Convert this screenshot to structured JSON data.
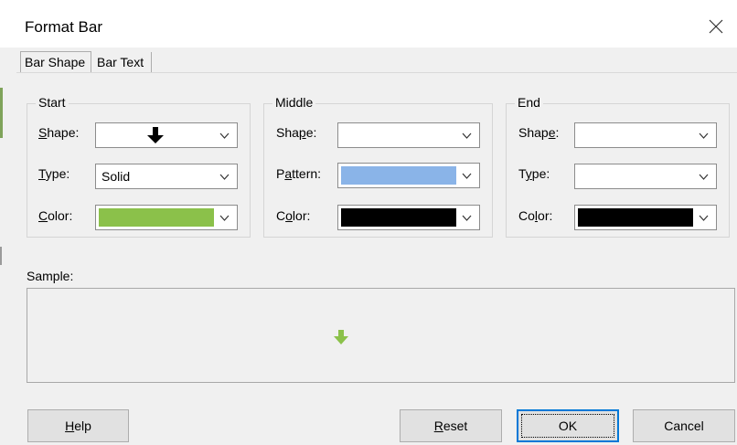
{
  "window": {
    "title": "Format Bar"
  },
  "tabs": [
    {
      "label": "Bar Shape",
      "active": true
    },
    {
      "label": "Bar Text",
      "active": false
    }
  ],
  "groups": {
    "start": {
      "legend": "Start",
      "shape": {
        "label_pre": "",
        "label_ul": "S",
        "label_post": "hape:",
        "value_icon": "down-arrow-icon"
      },
      "type": {
        "label_pre": "",
        "label_ul": "T",
        "label_post": "ype:",
        "value": "Solid"
      },
      "color": {
        "label_pre": "",
        "label_ul": "C",
        "label_post": "olor:",
        "swatch": "#8bc14a"
      }
    },
    "middle": {
      "legend": "Middle",
      "shape": {
        "label_pre": "Sha",
        "label_ul": "p",
        "label_post": "e:",
        "value": ""
      },
      "pattern": {
        "label_pre": "P",
        "label_ul": "a",
        "label_post": "ttern:",
        "swatch": "#8ab4e8"
      },
      "color": {
        "label_pre": "C",
        "label_ul": "o",
        "label_post": "lor:",
        "swatch": "#000000"
      }
    },
    "end": {
      "legend": "End",
      "shape": {
        "label_pre": "Shap",
        "label_ul": "e",
        "label_post": ":",
        "value": ""
      },
      "type": {
        "label_pre": "T",
        "label_ul": "y",
        "label_post": "pe:",
        "value": ""
      },
      "color": {
        "label_pre": "Co",
        "label_ul": "l",
        "label_post": "or:",
        "swatch": "#000000"
      }
    }
  },
  "sample": {
    "label": "Sample:",
    "arrow_color": "#8bc14a"
  },
  "buttons": {
    "help": {
      "label_ul": "H",
      "label_post": "elp"
    },
    "reset": {
      "label_ul": "R",
      "label_post": "eset"
    },
    "ok": {
      "label": "OK"
    },
    "cancel": {
      "label": "Cancel"
    }
  }
}
